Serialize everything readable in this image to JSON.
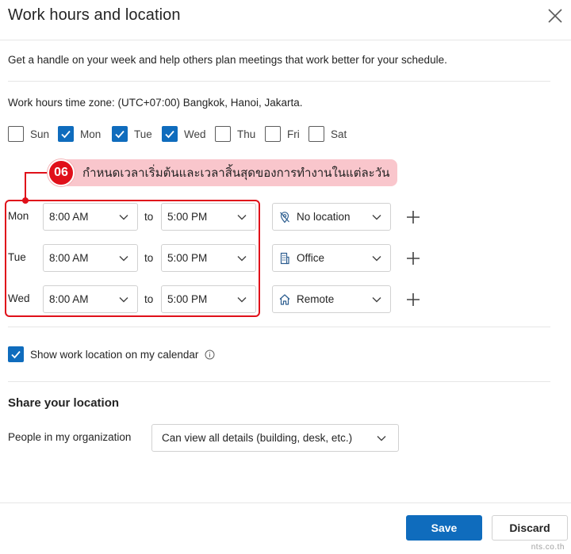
{
  "dialog": {
    "title": "Work hours and location",
    "intro": "Get a handle on your week and help others plan meetings that work better for your schedule.",
    "timezone_text": "Work hours time zone: (UTC+07:00) Bangkok, Hanoi, Jakarta."
  },
  "days": [
    {
      "label": "Sun",
      "checked": false
    },
    {
      "label": "Mon",
      "checked": true
    },
    {
      "label": "Tue",
      "checked": true
    },
    {
      "label": "Wed",
      "checked": true
    },
    {
      "label": "Thu",
      "checked": false
    },
    {
      "label": "Fri",
      "checked": false
    },
    {
      "label": "Sat",
      "checked": false
    }
  ],
  "callout": {
    "number": "06",
    "text": "กำหนดเวลาเริ่มต้นและเวลาสิ้นสุดของการทำงานในแต่ละวัน"
  },
  "rows": [
    {
      "day": "Mon",
      "start": "8:00 AM",
      "to": "to",
      "end": "5:00 PM",
      "location": "No location",
      "location_icon": "no-location-icon"
    },
    {
      "day": "Tue",
      "start": "8:00 AM",
      "to": "to",
      "end": "5:00 PM",
      "location": "Office",
      "location_icon": "building-icon"
    },
    {
      "day": "Wed",
      "start": "8:00 AM",
      "to": "to",
      "end": "5:00 PM",
      "location": "Remote",
      "location_icon": "home-icon"
    }
  ],
  "show_location": {
    "label": "Show work location on my calendar",
    "checked": true
  },
  "share": {
    "title": "Share your location",
    "people_label": "People in my organization",
    "people_value": "Can view all details (building, desk, etc.)"
  },
  "buttons": {
    "save": "Save",
    "discard": "Discard"
  },
  "watermark": "nts.co.th",
  "colors": {
    "accent": "#0f6cbd",
    "callout_red": "#e0101a",
    "callout_pink": "#f9c6cc"
  }
}
